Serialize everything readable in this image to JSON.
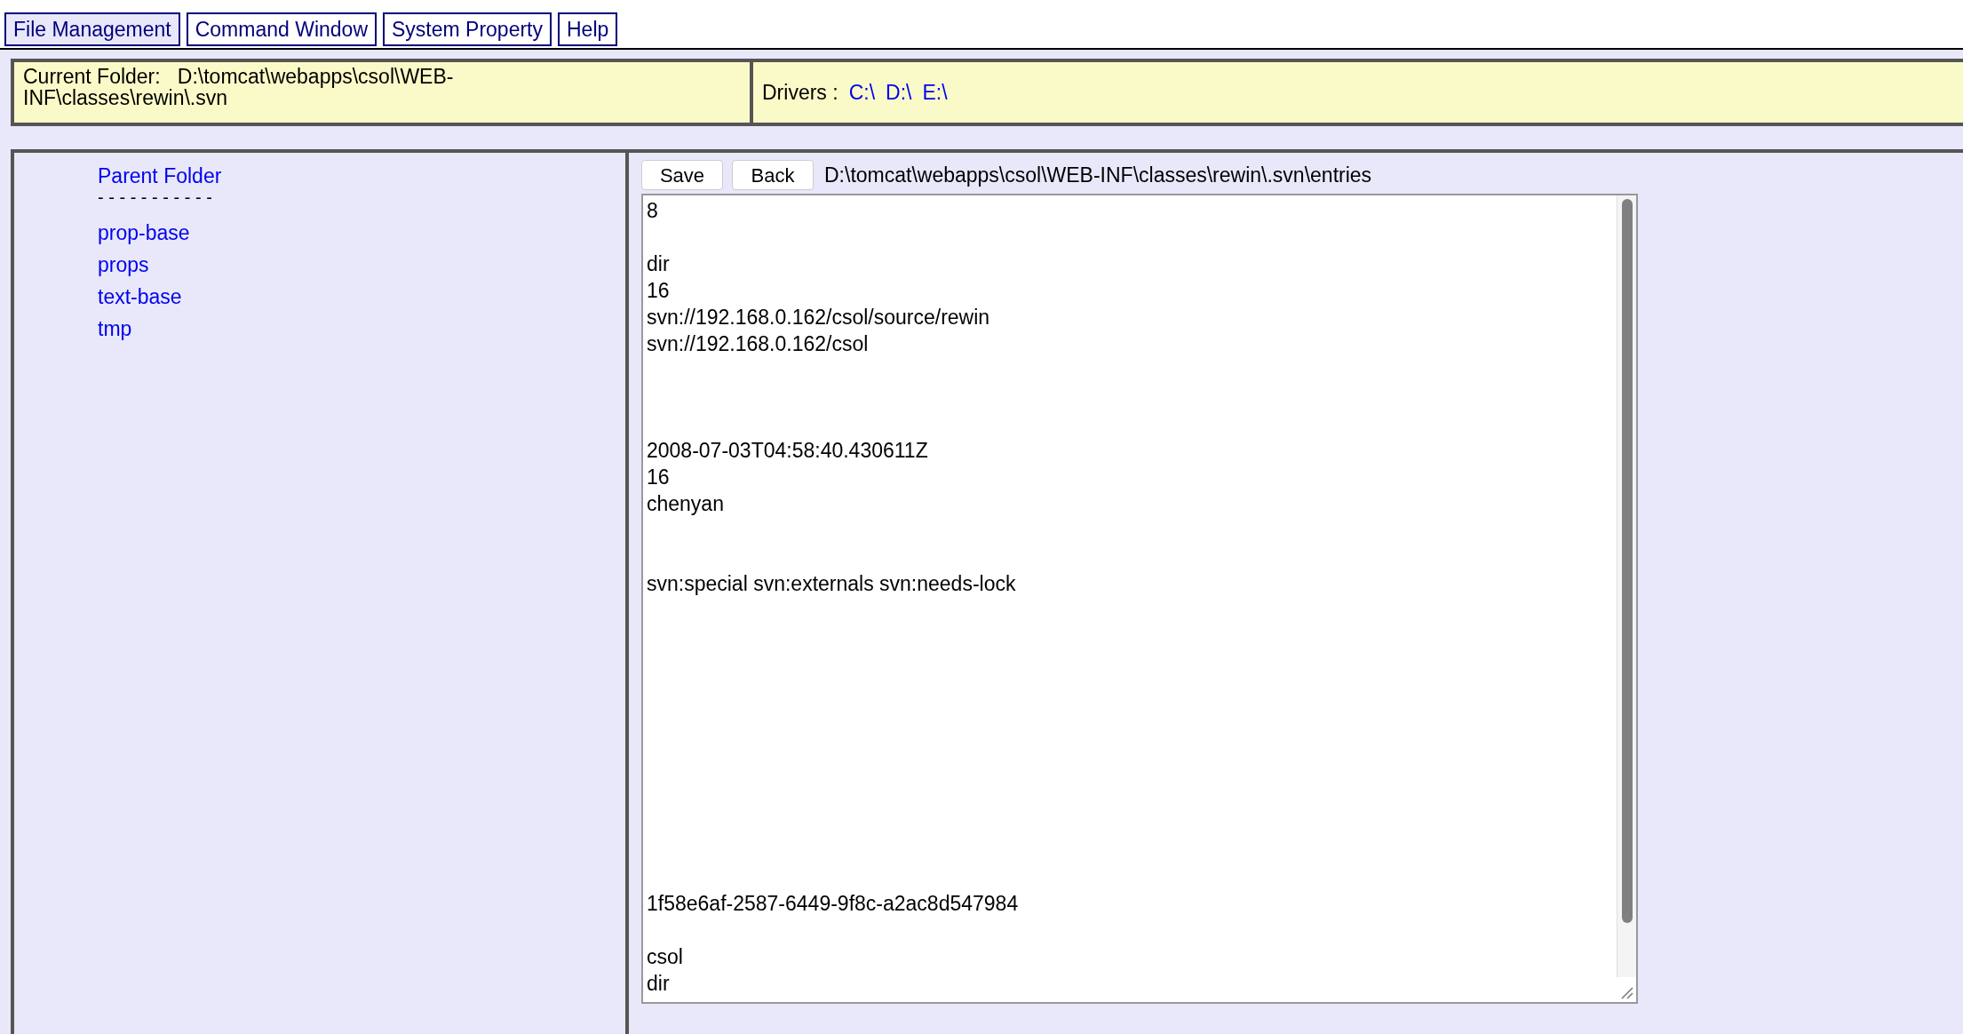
{
  "tabs": [
    {
      "label": "File Management",
      "selected": true
    },
    {
      "label": "Command Window",
      "selected": false
    },
    {
      "label": "System Property",
      "selected": false
    },
    {
      "label": "Help",
      "selected": false
    }
  ],
  "current_folder": {
    "label": "Current Folder:",
    "path": "D:\\tomcat\\webapps\\csol\\WEB-INF\\classes\\rewin\\.svn"
  },
  "drivers": {
    "label": "Drivers :",
    "links": [
      "C:\\",
      "D:\\",
      "E:\\"
    ]
  },
  "sidebar": {
    "parent_link": "Parent Folder",
    "separator": "- - - - - - - - - - -",
    "folders": [
      "prop-base",
      "props",
      "text-base",
      "tmp"
    ]
  },
  "editor": {
    "buttons": [
      "Save",
      "Back"
    ],
    "file_path": "D:\\tomcat\\webapps\\csol\\WEB-INF\\classes\\rewin\\.svn\\entries",
    "content": "8\n\ndir\n16\nsvn://192.168.0.162/csol/source/rewin\nsvn://192.168.0.162/csol\n\n\n\n2008-07-03T04:58:40.430611Z\n16\nchenyan\n\n\nsvn:special svn:externals svn:needs-lock\n\n\n\n\n\n\n\n\n\n\n\n1f58e6af-2587-6449-9f8c-a2ac8d547984\n\ncsol\ndir"
  }
}
